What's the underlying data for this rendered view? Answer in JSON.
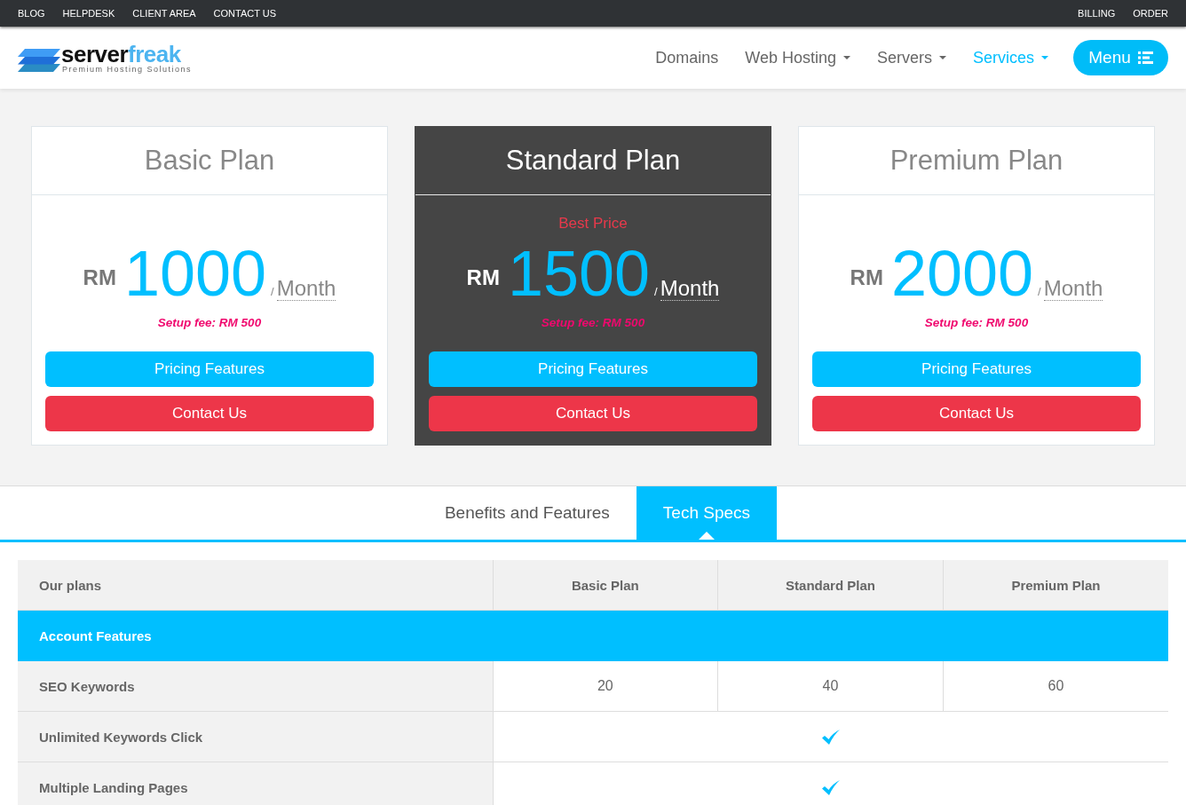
{
  "top_bar": {
    "left_links": [
      "BLOG",
      "HELPDESK",
      "CLIENT AREA",
      "CONTACT US"
    ],
    "right_links": [
      "BILLING",
      "ORDER"
    ]
  },
  "header": {
    "logo": {
      "brand": "server",
      "brand_accent": "freak",
      "tagline": "Premium Hosting Solutions"
    },
    "nav": [
      {
        "label": "Domains",
        "dropdown": false,
        "selected": false
      },
      {
        "label": "Web Hosting",
        "dropdown": true,
        "selected": false
      },
      {
        "label": "Servers",
        "dropdown": true,
        "selected": false
      },
      {
        "label": "Services",
        "dropdown": true,
        "selected": true
      }
    ],
    "menu_button": "Menu"
  },
  "plans": [
    {
      "name": "Basic Plan",
      "featured": false,
      "currency": "RM",
      "price": "1000",
      "separator": "/",
      "period": "Month",
      "setup_fee": "Setup fee: RM 500",
      "buttons": [
        {
          "kind": "features",
          "label": "Pricing Features"
        },
        {
          "kind": "contact",
          "label": "Contact Us"
        }
      ]
    },
    {
      "name": "Standard Plan",
      "featured": true,
      "badge": "Best Price",
      "currency": "RM",
      "price": "1500",
      "separator": "/",
      "period": "Month",
      "setup_fee": "Setup fee: RM 500",
      "buttons": [
        {
          "kind": "features",
          "label": "Pricing Features"
        },
        {
          "kind": "contact",
          "label": "Contact Us"
        }
      ]
    },
    {
      "name": "Premium Plan",
      "featured": false,
      "currency": "RM",
      "price": "2000",
      "separator": "/",
      "period": "Month",
      "setup_fee": "Setup fee: RM 500",
      "buttons": [
        {
          "kind": "features",
          "label": "Pricing Features"
        },
        {
          "kind": "contact",
          "label": "Contact Us"
        }
      ]
    }
  ],
  "tabs": [
    {
      "label": "Benefits and Features",
      "selected": false
    },
    {
      "label": "Tech Specs",
      "selected": true
    }
  ],
  "table": {
    "columns": [
      "Our plans",
      "Basic Plan",
      "Standard Plan",
      "Premium Plan"
    ],
    "rows": [
      {
        "kind": "section",
        "label": "Account Features"
      },
      {
        "kind": "values",
        "label": "SEO Keywords",
        "values": [
          "20",
          "40",
          "60"
        ]
      },
      {
        "kind": "check",
        "label": "Unlimited Keywords Click",
        "checked": true
      },
      {
        "kind": "check",
        "label": "Multiple Landing Pages",
        "checked": true
      }
    ]
  }
}
